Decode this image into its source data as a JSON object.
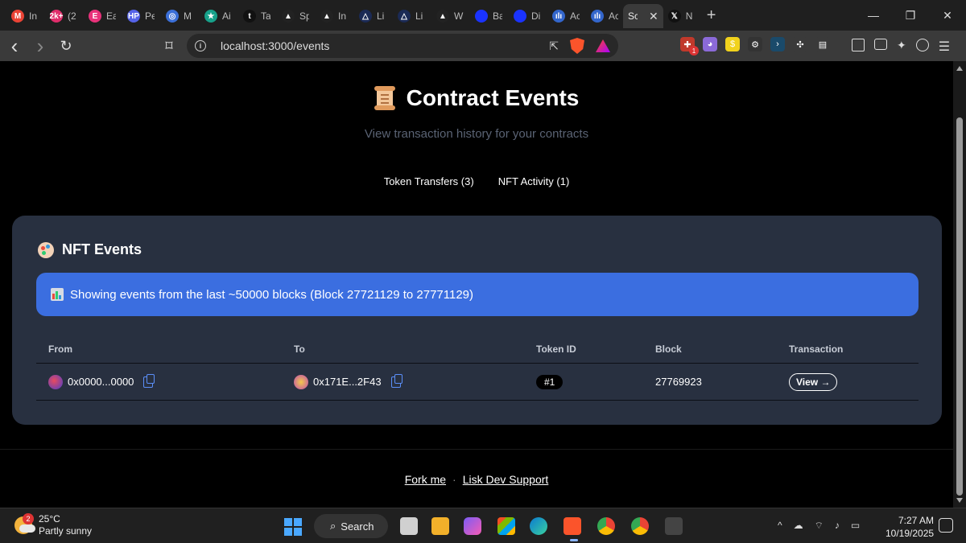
{
  "browser": {
    "tabs": [
      {
        "label": "In",
        "color": "#ea4335",
        "glyph": "M"
      },
      {
        "label": "(2",
        "color": "#e02d6b",
        "glyph": "2k+"
      },
      {
        "label": "Ea",
        "color": "#e8327a",
        "glyph": "E"
      },
      {
        "label": "Pe",
        "color": "#5563e8",
        "glyph": "HP"
      },
      {
        "label": "M",
        "color": "#3b6fd8",
        "glyph": "◎"
      },
      {
        "label": "Ai",
        "color": "#17a18a",
        "glyph": "★"
      },
      {
        "label": "Ta",
        "color": "#111111",
        "glyph": "t"
      },
      {
        "label": "Sp",
        "color": "#222222",
        "glyph": "▲"
      },
      {
        "label": "In",
        "color": "#222222",
        "glyph": "▲"
      },
      {
        "label": "Li",
        "color": "#1b2a55",
        "glyph": "△"
      },
      {
        "label": "Li",
        "color": "#1b2a55",
        "glyph": "△"
      },
      {
        "label": "W",
        "color": "#222222",
        "glyph": "▲"
      },
      {
        "label": "Ba",
        "color": "#1a33ff",
        "glyph": ""
      },
      {
        "label": "Di",
        "color": "#1a33ff",
        "glyph": ""
      },
      {
        "label": "Ac",
        "color": "#3366cc",
        "glyph": "ılı"
      },
      {
        "label": "Ac",
        "color": "#3366cc",
        "glyph": "ılı"
      }
    ],
    "active_tab": {
      "label": "Sc",
      "close": "✕"
    },
    "after_active_tab": {
      "label": "N",
      "glyph": "𝕏"
    },
    "new_tab": "+",
    "window_controls": {
      "minimize": "—",
      "restore": "❐",
      "close": "✕"
    },
    "nav": {
      "back": "‹",
      "forward": "›",
      "reload": "↻",
      "bookmark": "⌑"
    },
    "url": "localhost:3000/events",
    "rewards_badge": "1",
    "extensions": [
      {
        "name": "ext-red",
        "color": "#c0392b",
        "glyph": "✚",
        "badge": "1"
      },
      {
        "name": "ext-purple",
        "color": "#8b6ad8",
        "glyph": "◕",
        "badge": ""
      },
      {
        "name": "ext-yellow",
        "color": "#f1d21c",
        "glyph": "$",
        "badge": ""
      },
      {
        "name": "ext-dark",
        "color": "#333333",
        "glyph": "⚙",
        "badge": ""
      },
      {
        "name": "ext-arrow",
        "color": "#1a4a6a",
        "glyph": "›",
        "badge": ""
      },
      {
        "name": "ext-puzzle",
        "color": "#3a3a3a",
        "glyph": "✣",
        "badge": ""
      },
      {
        "name": "ext-reader",
        "color": "#3a3a3a",
        "glyph": "▤",
        "badge": ""
      }
    ]
  },
  "page": {
    "title": "Contract Events",
    "subtitle": "View transaction history for your contracts",
    "tabs": [
      "Token Transfers (3)",
      "NFT Activity (1)"
    ],
    "card": {
      "title": "NFT Events",
      "notice": "Showing events from the last ~50000 blocks (Block 27721129 to 27771129)",
      "columns": [
        "From",
        "To",
        "Token ID",
        "Block",
        "Transaction"
      ],
      "rows": [
        {
          "from": "0x0000...0000",
          "to": "0x171E...2F43",
          "token_id": "#1",
          "block": "27769923",
          "action": "View →"
        }
      ]
    },
    "footer": {
      "link1": "Fork me",
      "separator": "·",
      "link2": "Lisk Dev Support"
    }
  },
  "taskbar": {
    "weather": {
      "temp": "25°C",
      "desc": "Partly sunny",
      "badge": "2"
    },
    "search": "Search",
    "time": "7:27 AM",
    "date": "10/19/2025"
  }
}
